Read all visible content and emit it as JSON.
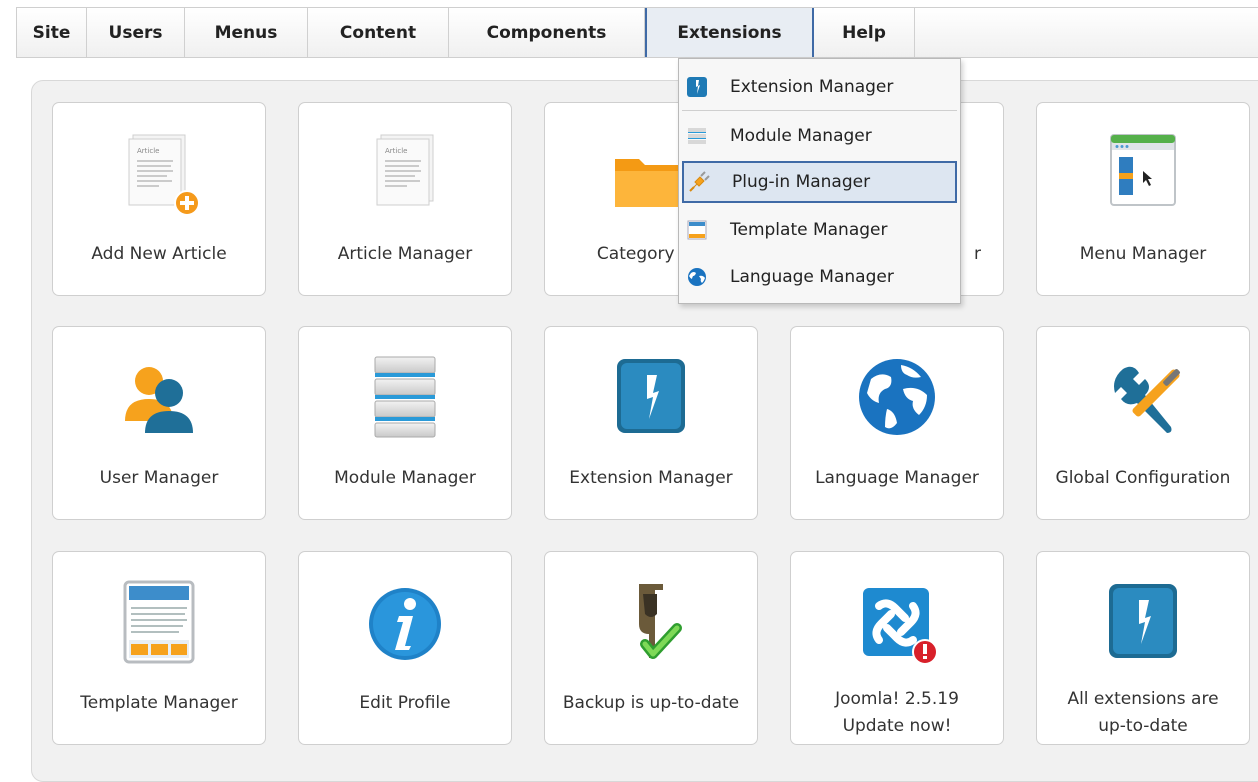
{
  "menubar": {
    "items": [
      {
        "label": "Site"
      },
      {
        "label": "Users"
      },
      {
        "label": "Menus"
      },
      {
        "label": "Content"
      },
      {
        "label": "Components"
      },
      {
        "label": "Extensions"
      },
      {
        "label": "Help"
      }
    ],
    "active": "Extensions"
  },
  "dropdown": {
    "items": [
      {
        "label": "Extension Manager",
        "icon": "extension-icon"
      },
      {
        "label": "Module Manager",
        "icon": "module-icon"
      },
      {
        "label": "Plug-in Manager",
        "icon": "plugin-icon"
      },
      {
        "label": "Template Manager",
        "icon": "template-icon"
      },
      {
        "label": "Language Manager",
        "icon": "language-icon"
      }
    ],
    "highlighted": "Plug-in Manager"
  },
  "tiles": {
    "row1": [
      {
        "label": "Add New Article",
        "icon": "add-article-icon"
      },
      {
        "label": "Article Manager",
        "icon": "article-icon"
      },
      {
        "label": "Category Ma",
        "icon": "folder-icon"
      },
      {
        "label": "r",
        "icon": "media-icon"
      },
      {
        "label": "Menu Manager",
        "icon": "menu-manager-icon"
      }
    ],
    "row2": [
      {
        "label": "User Manager",
        "icon": "users-icon"
      },
      {
        "label": "Module Manager",
        "icon": "module-manager-icon"
      },
      {
        "label": "Extension Manager",
        "icon": "extension-manager-icon"
      },
      {
        "label": "Language Manager",
        "icon": "globe-icon"
      },
      {
        "label": "Global Configuration",
        "icon": "tools-icon"
      }
    ],
    "row3": [
      {
        "label": "Template Manager",
        "icon": "template-manager-icon"
      },
      {
        "label": "Edit Profile",
        "icon": "info-icon"
      },
      {
        "label": "Backup is up-to-date",
        "icon": "backup-icon"
      },
      {
        "label_line1": "Joomla! 2.5.19",
        "label_line2": "Update now!",
        "icon": "joomla-icon"
      },
      {
        "label_line1": "All extensions are",
        "label_line2": "up-to-date",
        "icon": "extensions-uptodate-icon"
      }
    ]
  },
  "colors": {
    "accent": "#3f6aa6",
    "orange": "#f6a21d",
    "blue": "#1f7fc2"
  }
}
